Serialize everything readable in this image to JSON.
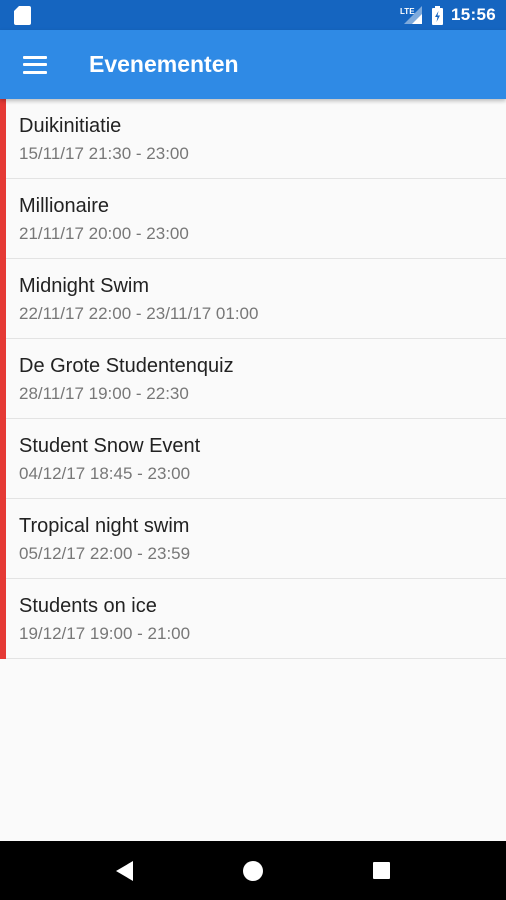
{
  "status_bar": {
    "network_label": "LTE",
    "time": "15:56"
  },
  "app_bar": {
    "title": "Evenementen",
    "menu_icon": "hamburger-menu-icon"
  },
  "colors": {
    "status_bar": "#1565c0",
    "app_bar": "#2f8ae5",
    "event_accent": "#e53935",
    "background": "#fafafa"
  },
  "events": [
    {
      "title": "Duikinitiatie",
      "time": "15/11/17 21:30 - 23:00"
    },
    {
      "title": "Millionaire",
      "time": "21/11/17 20:00 - 23:00"
    },
    {
      "title": "Midnight Swim",
      "time": "22/11/17 22:00 - 23/11/17 01:00"
    },
    {
      "title": "De Grote Studentenquiz",
      "time": "28/11/17 19:00 - 22:30"
    },
    {
      "title": "Student Snow Event",
      "time": "04/12/17 18:45 - 23:00"
    },
    {
      "title": "Tropical night swim",
      "time": "05/12/17 22:00 - 23:59"
    },
    {
      "title": "Students on ice",
      "time": "19/12/17 19:00 - 21:00"
    }
  ],
  "nav_bar": {
    "back_icon": "back-triangle-icon",
    "home_icon": "home-circle-icon",
    "recents_icon": "recents-square-icon"
  }
}
